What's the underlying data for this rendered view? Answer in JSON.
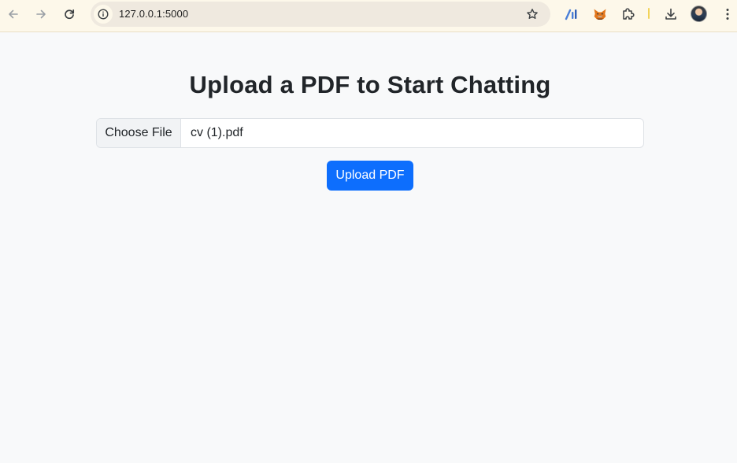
{
  "browser": {
    "url": "127.0.0.1:5000",
    "icons": {
      "back": "arrow-left-icon",
      "forward": "arrow-right-icon",
      "reload": "reload-icon",
      "site_info": "info-icon",
      "bookmark": "star-icon",
      "extension_1": "chart-bars-icon",
      "extension_2": "fox-icon",
      "extensions": "puzzle-icon",
      "downloads": "download-icon",
      "menu": "more-vertical-icon"
    }
  },
  "page": {
    "title": "Upload a PDF to Start Chatting",
    "file_input": {
      "button_label": "Choose File",
      "selected_file": "cv (1).pdf"
    },
    "upload_button_label": "Upload PDF"
  },
  "colors": {
    "page_background": "#f8f9fa",
    "toolbar_background": "#fdf8ea",
    "primary_button": "#0d6efd",
    "title_text": "#212529"
  }
}
